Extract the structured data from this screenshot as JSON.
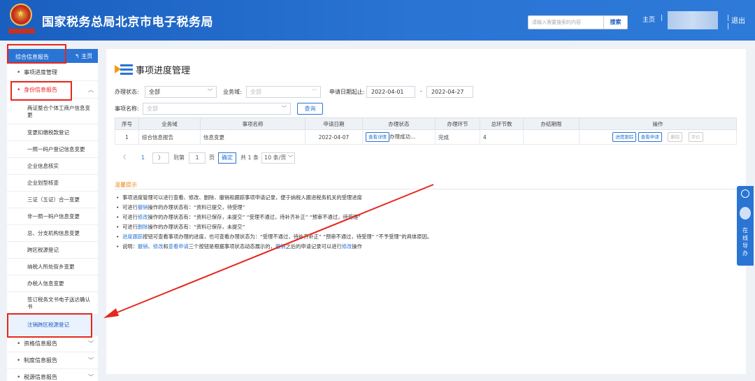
{
  "header": {
    "title": "国家税务总局北京市电子税务局",
    "search_placeholder": "请输入需要搜索的内容",
    "search_button": "搜索",
    "home": "主页",
    "separator": "|",
    "logout": "退出"
  },
  "sidebar": {
    "top_label": "综合信息报告",
    "home_link": "主页",
    "items": [
      {
        "label": "事项进度管理"
      },
      {
        "label": "身份信息报告"
      },
      {
        "label": "资格信息报告"
      },
      {
        "label": "制度信息报告"
      },
      {
        "label": "税源信息报告"
      }
    ],
    "sub_items": [
      {
        "label": "两证整合个体工商户信息变更"
      },
      {
        "label": "变更扣缴税款登记"
      },
      {
        "label": "一照一码户登记信息变更"
      },
      {
        "label": "企业信息核实"
      },
      {
        "label": "企业划型核查"
      },
      {
        "label": "三证（五证）合一变更"
      },
      {
        "label": "非一照一码户信息变更"
      },
      {
        "label": "总、分支机构信息变更"
      },
      {
        "label": "跨区税源登记"
      },
      {
        "label": "纳税人所处街乡变更"
      },
      {
        "label": "办税人信息变更"
      },
      {
        "label": "签订税务文书电子送达确认书"
      },
      {
        "label": "注销跨区税源登记"
      }
    ]
  },
  "main": {
    "page_title": "事项进度管理",
    "filters": {
      "status_label": "办理状态:",
      "status_value": "全部",
      "domain_label": "业务域:",
      "domain_value": "全部",
      "date_label": "申请日期起止:",
      "date_start": "2022-04-01",
      "date_sep": "-",
      "date_end": "2022-04-27",
      "name_label": "事项名称:",
      "name_value": "全部",
      "query_button": "查询"
    },
    "table": {
      "headers": [
        "序号",
        "业务域",
        "事项名称",
        "申请日期",
        "办理状态",
        "办理环节",
        "总环节数",
        "办结期限",
        "操作"
      ],
      "rows": [
        {
          "index": "1",
          "domain": "综合信息报告",
          "name": "信息变更",
          "date": "2022-04-07",
          "detail_btn": "查看详情",
          "status": "办理成功...",
          "step": "完成",
          "total": "4",
          "deadline": "",
          "actions": [
            "进度跟踪",
            "查看申请",
            "删除",
            "评价"
          ]
        }
      ]
    },
    "pager": {
      "current": "1",
      "goto_label": "到第",
      "goto_value": "1",
      "page_unit": "页",
      "confirm": "确定",
      "total": "共 1 条",
      "page_size": "10 条/页"
    },
    "tips": {
      "title": "温馨提示",
      "lines": [
        {
          "parts": [
            {
              "t": "事项进度管理可以进行查看、修改、删除、撤销和跟踪事项申请记录，便于纳税人跟进税务机关的受理进度",
              "h": false
            }
          ]
        },
        {
          "parts": [
            {
              "t": "可进行",
              "h": false
            },
            {
              "t": "撤销",
              "h": true
            },
            {
              "t": "操作的办理状态有：“资料已提交，待受理”",
              "h": false
            }
          ]
        },
        {
          "parts": [
            {
              "t": "可进行",
              "h": false
            },
            {
              "t": "修改",
              "h": true
            },
            {
              "t": "操作的办理状态有：“资料已保存，未提交”   “受理不通过，待补齐补正”   “预审不通过，待受理”",
              "h": false
            }
          ]
        },
        {
          "parts": [
            {
              "t": "可进行",
              "h": false
            },
            {
              "t": "删除",
              "h": true
            },
            {
              "t": "操作的办理状态有：“资料已保存，未提交”",
              "h": false
            }
          ]
        },
        {
          "parts": [
            {
              "t": "进度跟踪",
              "h": true
            },
            {
              "t": "按钮可查看事项办理的进度，也可查看办理状态为：“受理不通过，待补齐补正”   “预审不通过，待受理”   “不予受理”的具体原因。",
              "h": false
            }
          ]
        },
        {
          "parts": [
            {
              "t": "说明：",
              "h": false
            },
            {
              "t": "撤销",
              "h": true
            },
            {
              "t": "、",
              "h": false
            },
            {
              "t": "修改",
              "h": true
            },
            {
              "t": "和",
              "h": false
            },
            {
              "t": "查看申请",
              "h": true
            },
            {
              "t": "三个按钮是根据事项状态动态展示的，",
              "h": false
            },
            {
              "t": "撤销",
              "h": true
            },
            {
              "t": "之后的申请记录可以进行",
              "h": false
            },
            {
              "t": "修改",
              "h": true
            },
            {
              "t": "操作",
              "h": false
            }
          ]
        }
      ]
    }
  },
  "float_widget": {
    "text": "在线导办"
  },
  "colors": {
    "header_blue": "#2a74d4",
    "annotation_red": "#e6271d",
    "tip_orange": "#e88a1a"
  }
}
